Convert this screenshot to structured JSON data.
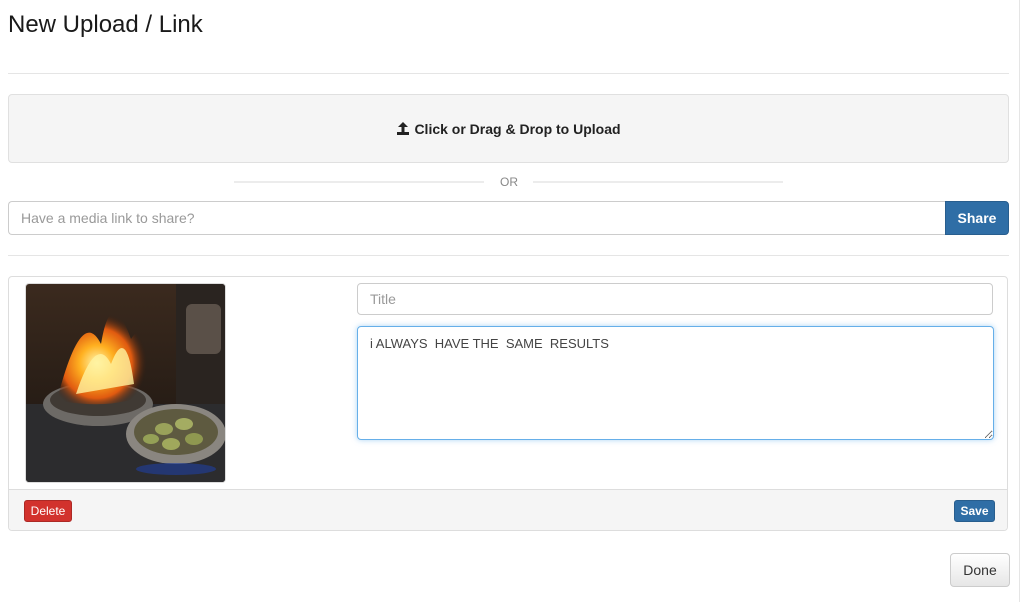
{
  "modal": {
    "title": "New Upload / Link"
  },
  "dropzone": {
    "label": "Click or Drag & Drop to Upload",
    "icon": "upload-icon"
  },
  "divider": {
    "or_text": "OR"
  },
  "link_share": {
    "placeholder": "Have a media link to share?",
    "value": "",
    "share_label": "Share"
  },
  "upload_item": {
    "image_alt": "flambe-pan-photo",
    "title_placeholder": "Title",
    "title_value": "",
    "description_value": "i ALWAYS  HAVE THE  SAME  RESULTS",
    "delete_label": "Delete",
    "save_label": "Save"
  },
  "footer": {
    "done_label": "Done"
  },
  "colors": {
    "primary": "#2f6ea6",
    "danger": "#d2322d",
    "focus_border": "#66afe9",
    "panel_bg": "#f5f5f5"
  }
}
